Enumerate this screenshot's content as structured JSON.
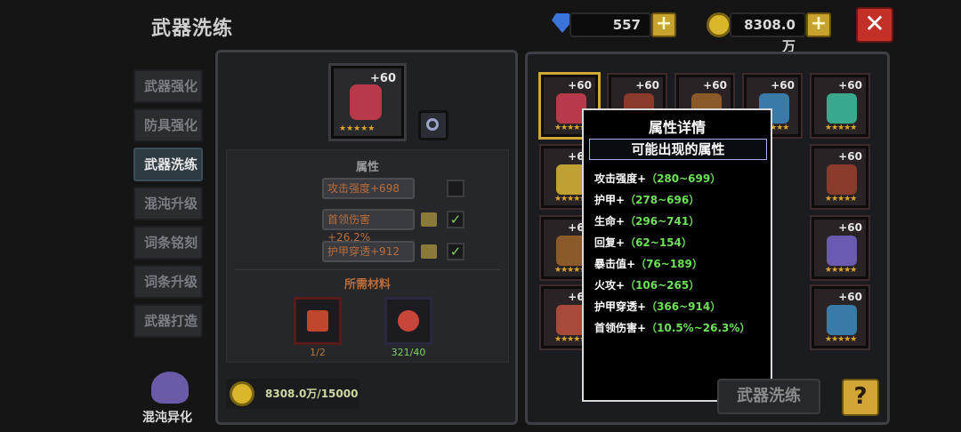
{
  "header": {
    "title": "武器洗练",
    "gems": "557",
    "gold": "8308.0万"
  },
  "tabs": [
    {
      "label": "武器强化",
      "active": false
    },
    {
      "label": "防具强化",
      "active": false
    },
    {
      "label": "武器洗练",
      "active": true
    },
    {
      "label": "混沌升级",
      "active": false
    },
    {
      "label": "词条铭刻",
      "active": false
    },
    {
      "label": "词条升级",
      "active": false
    },
    {
      "label": "武器打造",
      "active": false
    }
  ],
  "chaos": {
    "label": "混沌异化"
  },
  "selected_weapon": {
    "level": "+60"
  },
  "attributes": {
    "heading": "属性",
    "items": [
      {
        "text": "攻击强度+698",
        "locked": false,
        "checked": false
      },
      {
        "text": "首领伤害+26.2%",
        "locked": true,
        "checked": true
      },
      {
        "text": "护甲穿透+912",
        "locked": true,
        "checked": true
      }
    ]
  },
  "materials": {
    "heading": "所需材料",
    "items": [
      {
        "count": "1/2"
      },
      {
        "count": "321/40"
      }
    ]
  },
  "coin_cost": "8308.0万/15000",
  "grid_level": "+60",
  "popup": {
    "title": "属性详情",
    "subtitle": "可能出现的属性",
    "props": [
      {
        "name": "攻击强度+",
        "range": "（280~699）"
      },
      {
        "name": "护甲+",
        "range": "（278~696）"
      },
      {
        "name": "生命+",
        "range": "（296~741）"
      },
      {
        "name": "回复+",
        "range": "（62~154）"
      },
      {
        "name": "暴击值+",
        "range": "（76~189）"
      },
      {
        "name": "火攻+",
        "range": "（106~265）"
      },
      {
        "name": "护甲穿透+",
        "range": "（366~914）"
      },
      {
        "name": "首领伤害+",
        "range": "（10.5%~26.3%）"
      }
    ]
  },
  "wash_button": "武器洗练",
  "help_button": "?",
  "close_button": "✕",
  "icons": {
    "plus": "+",
    "check": "✓",
    "stars": "★★★★★"
  },
  "colors": {
    "accent_gold": "#d1a637",
    "range_green": "#6fe05a",
    "close_red": "#c23028"
  }
}
